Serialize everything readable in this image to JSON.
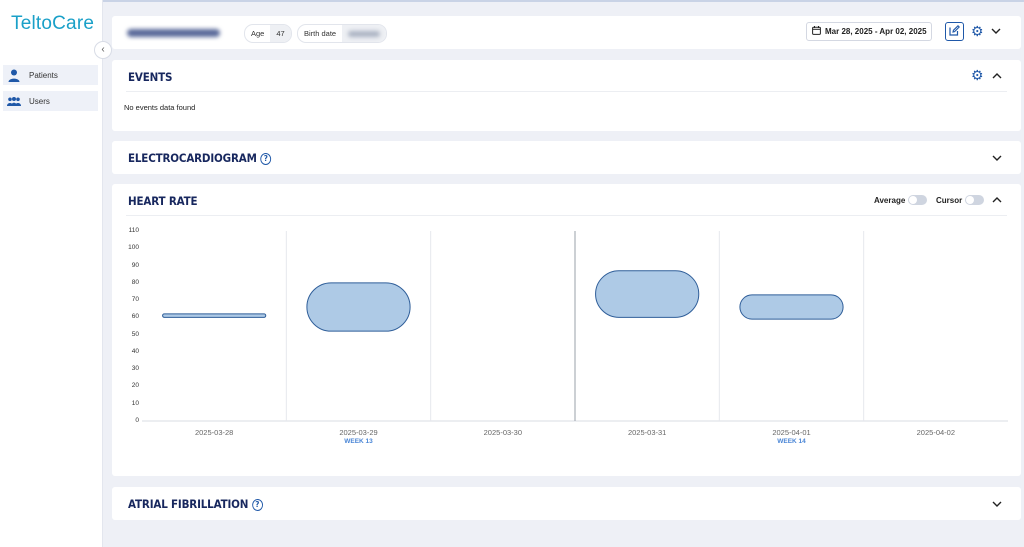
{
  "app": {
    "logo": "TeltoCare"
  },
  "sidebar": {
    "collapse_glyph": "‹",
    "items": [
      {
        "label": "Patients",
        "icon": "user-icon"
      },
      {
        "label": "Users",
        "icon": "users-icon"
      }
    ]
  },
  "header": {
    "age_label": "Age",
    "age_value": "47",
    "birth_label": "Birth date",
    "date_range": "Mar 28, 2025 - Apr 02, 2025"
  },
  "events": {
    "title": "EVENTS",
    "empty_text": "No events data found"
  },
  "ecg": {
    "title": "ELECTROCARDIOGRAM"
  },
  "heart_rate": {
    "title": "HEART RATE",
    "average_label": "Average",
    "cursor_label": "Cursor"
  },
  "afib": {
    "title": "ATRIAL FIBRILLATION"
  },
  "colors": {
    "accent": "#1f58a8",
    "title": "#17275e",
    "band_fill": "#aecae6",
    "band_stroke": "#2f5e99",
    "logo": "#1aa0c8"
  },
  "chart_data": {
    "type": "area",
    "title": "HEART RATE",
    "ylim": [
      0,
      110
    ],
    "yticks": [
      110,
      100,
      90,
      80,
      70,
      60,
      50,
      40,
      30,
      20,
      10,
      0
    ],
    "categories": [
      "2025-03-28",
      "2025-03-29",
      "2025-03-30",
      "2025-03-31",
      "2025-04-01",
      "2025-04-02"
    ],
    "week_labels": [
      {
        "category": "2025-03-29",
        "label": "WEEK 13"
      },
      {
        "category": "2025-04-01",
        "label": "WEEK 14"
      }
    ],
    "ranges": [
      {
        "date": "2025-03-28",
        "min": 60,
        "max": 62
      },
      {
        "date": "2025-03-29",
        "min": 52,
        "max": 80
      },
      {
        "date": "2025-03-31",
        "min": 60,
        "max": 87
      },
      {
        "date": "2025-04-01",
        "min": 59,
        "max": 73
      }
    ],
    "grid": "vertical"
  }
}
